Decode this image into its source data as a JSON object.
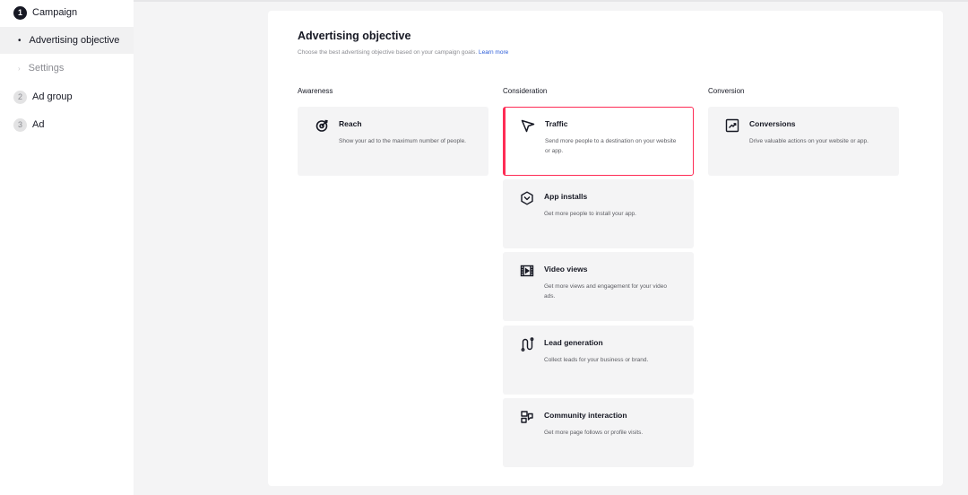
{
  "sidebar": {
    "steps": [
      {
        "num": "1",
        "label": "Campaign"
      },
      {
        "num": "2",
        "label": "Ad group"
      },
      {
        "num": "3",
        "label": "Ad"
      }
    ],
    "sub_items": [
      {
        "label": "Advertising objective",
        "marker": "•"
      },
      {
        "label": "Settings",
        "marker": "›"
      }
    ]
  },
  "panel": {
    "title": "Advertising objective",
    "subtitle": "Choose the best advertising objective based on your campaign goals.",
    "learn_more": "Learn more",
    "columns": [
      {
        "heading": "Awareness",
        "cards": [
          {
            "title": "Reach",
            "description": "Show your ad to the maximum number of people.",
            "icon": "reach-icon",
            "selected": false
          }
        ]
      },
      {
        "heading": "Consideration",
        "cards": [
          {
            "title": "Traffic",
            "description": "Send more people to a destination on your website or app.",
            "icon": "traffic-icon",
            "selected": true
          },
          {
            "title": "App installs",
            "description": "Get more people to install your app.",
            "icon": "app-installs-icon",
            "selected": false
          },
          {
            "title": "Video views",
            "description": "Get more views and engagement for your video ads.",
            "icon": "video-views-icon",
            "selected": false
          },
          {
            "title": "Lead generation",
            "description": "Collect leads for your business or brand.",
            "icon": "lead-generation-icon",
            "selected": false
          },
          {
            "title": "Community interaction",
            "description": "Get more page follows or profile visits.",
            "icon": "community-interaction-icon",
            "selected": false
          }
        ]
      },
      {
        "heading": "Conversion",
        "cards": [
          {
            "title": "Conversions",
            "description": "Drive valuable actions on your website or app.",
            "icon": "conversions-icon",
            "selected": false
          }
        ]
      }
    ]
  },
  "colors": {
    "accent": "#fe2c55",
    "link": "#2a5bd7",
    "card_bg": "#f4f4f5"
  }
}
